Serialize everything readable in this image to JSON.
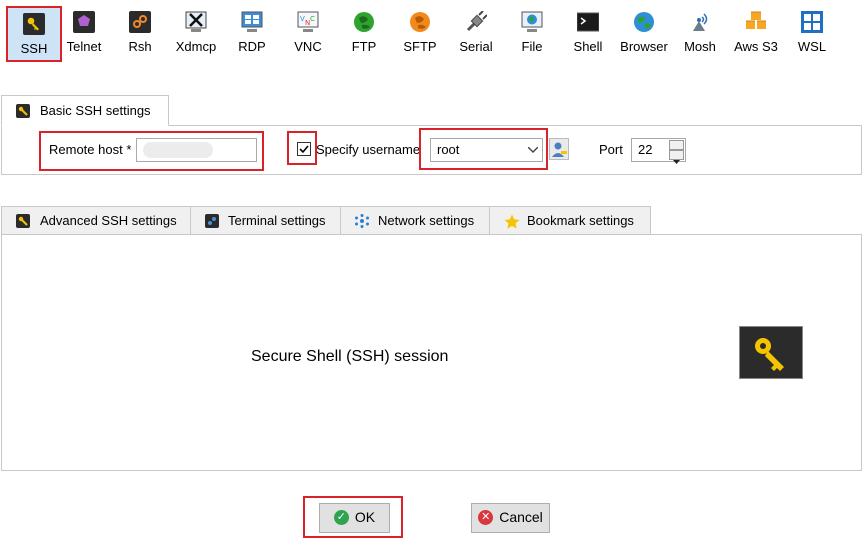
{
  "toolbar": {
    "items": [
      {
        "label": "SSH",
        "icon": "ssh-key-icon"
      },
      {
        "label": "Telnet",
        "icon": "telnet-icon"
      },
      {
        "label": "Rsh",
        "icon": "rsh-icon"
      },
      {
        "label": "Xdmcp",
        "icon": "xdmcp-icon"
      },
      {
        "label": "RDP",
        "icon": "rdp-icon"
      },
      {
        "label": "VNC",
        "icon": "vnc-icon"
      },
      {
        "label": "FTP",
        "icon": "ftp-icon"
      },
      {
        "label": "SFTP",
        "icon": "sftp-icon"
      },
      {
        "label": "Serial",
        "icon": "serial-plug-icon"
      },
      {
        "label": "File",
        "icon": "file-icon"
      },
      {
        "label": "Shell",
        "icon": "shell-terminal-icon"
      },
      {
        "label": "Browser",
        "icon": "browser-globe-icon"
      },
      {
        "label": "Mosh",
        "icon": "mosh-icon"
      },
      {
        "label": "Aws S3",
        "icon": "aws-s3-icon"
      },
      {
        "label": "WSL",
        "icon": "wsl-windows-icon"
      }
    ],
    "selected": "SSH"
  },
  "basic_tab": {
    "label": "Basic SSH settings"
  },
  "basic": {
    "remote_host_label": "Remote host *",
    "remote_host_value": "",
    "specify_username_label": "Specify username",
    "specify_username_checked": true,
    "username_value": "root",
    "port_label": "Port",
    "port_value": "22"
  },
  "adv_tabs": [
    {
      "label": "Advanced SSH settings",
      "icon": "wrench-key-icon"
    },
    {
      "label": "Terminal settings",
      "icon": "terminal-icon"
    },
    {
      "label": "Network settings",
      "icon": "network-icon"
    },
    {
      "label": "Bookmark settings",
      "icon": "star-icon"
    }
  ],
  "session": {
    "description": "Secure Shell (SSH) session",
    "icon": "key-icon"
  },
  "buttons": {
    "ok_label": "OK",
    "cancel_label": "Cancel"
  },
  "colors": {
    "accent_red": "#d8232a",
    "selected_bg": "#cfe3f7",
    "key_yellow": "#f5c400",
    "ok_green": "#2ea44f",
    "cancel_red": "#d9363e"
  }
}
